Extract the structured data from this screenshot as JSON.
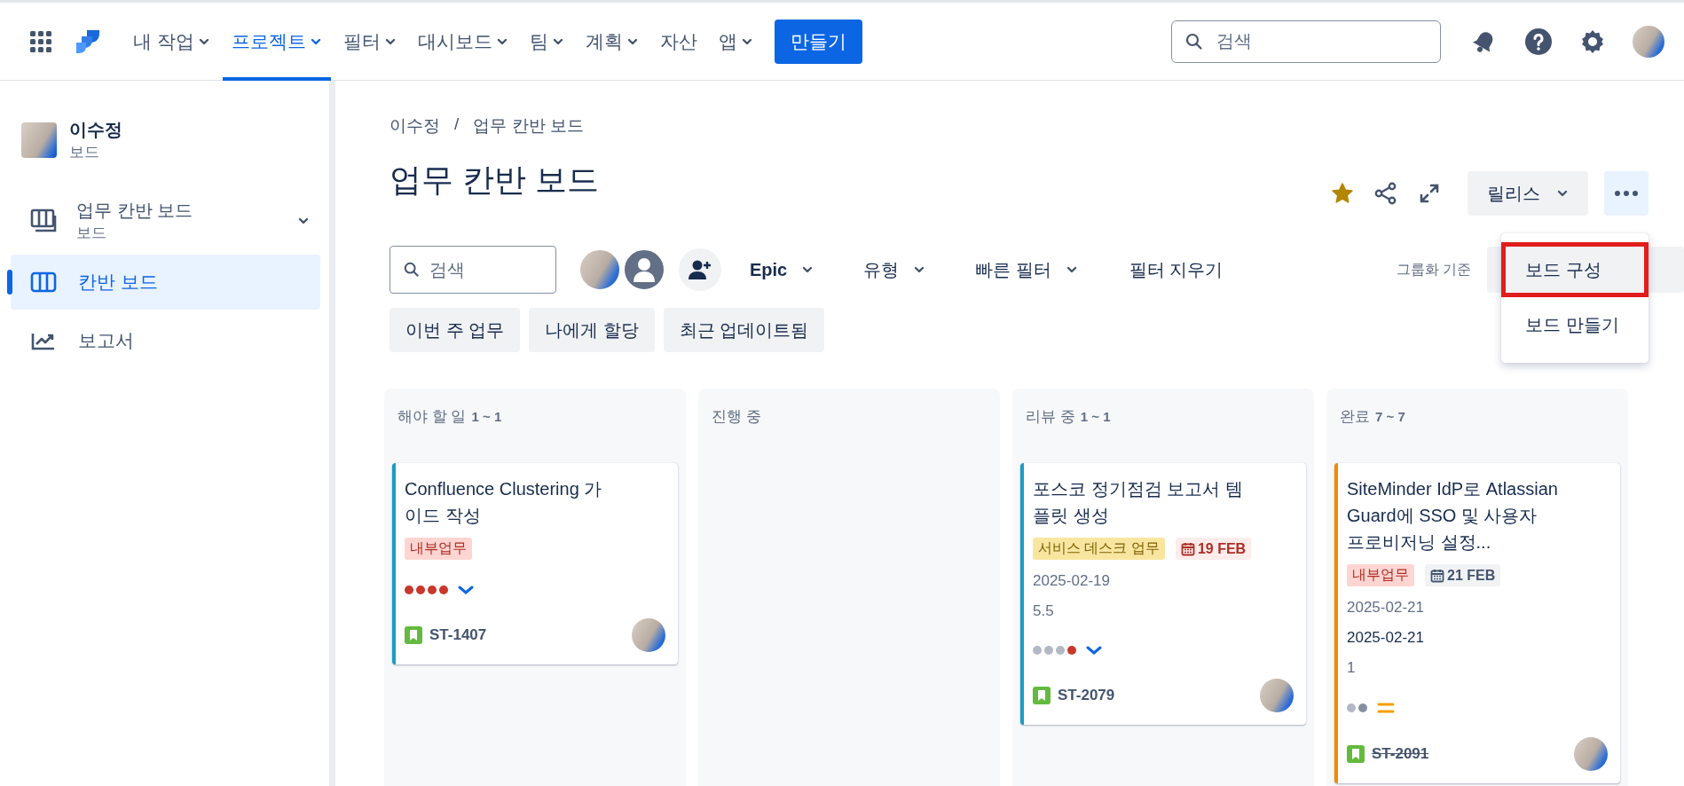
{
  "nav": {
    "items": [
      {
        "label": "내 작업",
        "dropdown": true,
        "selected": false
      },
      {
        "label": "프로젝트",
        "dropdown": true,
        "selected": true
      },
      {
        "label": "필터",
        "dropdown": true,
        "selected": false
      },
      {
        "label": "대시보드",
        "dropdown": true,
        "selected": false
      },
      {
        "label": "팀",
        "dropdown": true,
        "selected": false
      },
      {
        "label": "계획",
        "dropdown": true,
        "selected": false
      },
      {
        "label": "자산",
        "dropdown": false,
        "selected": false
      },
      {
        "label": "앱",
        "dropdown": true,
        "selected": false
      }
    ],
    "create_button": "만들기",
    "search": {
      "placeholder": "검색"
    }
  },
  "sidebar": {
    "project": {
      "name": "이수정",
      "type": "보드"
    },
    "board": {
      "name": "업무 칸반 보드",
      "type": "보드"
    },
    "items": [
      {
        "label": "칸반 보드",
        "kind": "board",
        "selected": true
      },
      {
        "label": "보고서",
        "kind": "chart",
        "selected": false
      }
    ]
  },
  "header": {
    "breadcrumb": {
      "items": [
        "이수정",
        "업무 칸반 보드"
      ],
      "separator": "/"
    },
    "title": "업무 칸반 보드",
    "starred": true,
    "release_button": "릴리스",
    "more_menu": {
      "items": [
        {
          "label": "보드 구성",
          "selected": true
        },
        {
          "label": "보드 만들기",
          "selected": false
        }
      ]
    }
  },
  "filters": {
    "search": {
      "placeholder": "검색"
    },
    "dropdowns": [
      {
        "label": "Epic",
        "emphasis": true
      },
      {
        "label": "유형",
        "emphasis": false
      },
      {
        "label": "빠른 필터",
        "emphasis": false
      }
    ],
    "clear": "필터 지우기",
    "group_by": "그룹화 기준",
    "quick_filters": [
      "이번 주 업무",
      "나에게 할당",
      "최근 업데이트됨"
    ]
  },
  "columns": [
    {
      "name": "해야 할 일",
      "count": "1 ~ 1",
      "cards": [
        {
          "title": "Confluence Clustering 가이드 작성",
          "color": "#1d9bc4",
          "labels": [
            {
              "kind": "label",
              "text": "내부업무",
              "color": "#ffd5d2"
            }
          ],
          "dots": [
            {
              "color": "#c9372c"
            },
            {
              "color": "#c9372c"
            },
            {
              "color": "#c9372c"
            },
            {
              "color": "#c9372c"
            }
          ],
          "priority": {
            "kind": "low"
          },
          "key": "ST-1407",
          "done": false
        }
      ]
    },
    {
      "name": "진행 중"
    },
    {
      "name": "리뷰 중",
      "count": "1 ~ 1",
      "cards": [
        {
          "title": "포스코 정기점검 보고서 템플릿 생성",
          "color": "#1d9bc4",
          "labels": [
            {
              "kind": "label",
              "text": "서비스 데스크 업무",
              "color": "#f8e6a0"
            },
            {
              "kind": "date",
              "text": "19 FEB",
              "overdue": true
            }
          ],
          "fields": [
            {
              "text": "2025-02-19",
              "strong": false
            },
            {
              "text": "5.5",
              "strong": false
            }
          ],
          "dots": [
            {
              "color": "#b3b9c4"
            },
            {
              "color": "#b3b9c4"
            },
            {
              "color": "#b3b9c4"
            },
            {
              "color": "#c9372c"
            }
          ],
          "priority": {
            "kind": "low"
          },
          "key": "ST-2079",
          "done": false
        }
      ]
    },
    {
      "name": "완료",
      "count": "7 ~ 7",
      "cards": [
        {
          "title": "SiteMinder IdP로 Atlassian Guard에 SSO 및 사용자 프로비저닝 설정...",
          "color": "#f38a00",
          "labels": [
            {
              "kind": "label",
              "text": "내부업무",
              "color": "#ffd5d2"
            },
            {
              "kind": "date",
              "text": "21 FEB",
              "overdue": false
            }
          ],
          "fields": [
            {
              "text": "2025-02-21",
              "strong": false
            },
            {
              "text": "2025-02-21",
              "strong": true
            },
            {
              "text": "1",
              "strong": false
            }
          ],
          "dots": [
            {
              "color": "#b3b9c4"
            },
            {
              "color": "#8590a2"
            }
          ],
          "priority": {
            "kind": "medium"
          },
          "key": "ST-2091",
          "done": true
        }
      ]
    }
  ]
}
